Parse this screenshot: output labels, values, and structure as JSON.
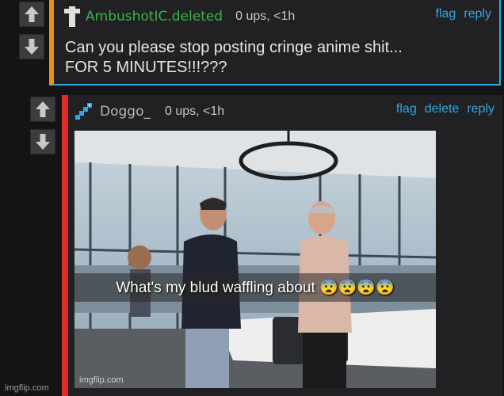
{
  "comment1": {
    "username": "AmbushotIC.deleted",
    "stats": "0 ups, <1h",
    "actions": [
      "flag",
      "reply"
    ],
    "text": "Can you please stop posting cringe anime shit...\nFOR 5 MINUTES!!!???"
  },
  "comment2": {
    "username": "Doggo_",
    "stats": "0 ups, <1h",
    "actions": [
      "flag",
      "delete",
      "reply"
    ],
    "meme": {
      "caption": "What's my blud waffling about 😨😨😨😨",
      "watermark": "imgflip.com"
    }
  },
  "footer": {
    "watermark": "imgflip.com"
  },
  "colors": {
    "background": "#141415",
    "panel": "#212123",
    "accent_orange": "#e8920f",
    "accent_red": "#e02b2b",
    "link_blue": "#33a8e2",
    "username_green": "#3bb34a"
  }
}
